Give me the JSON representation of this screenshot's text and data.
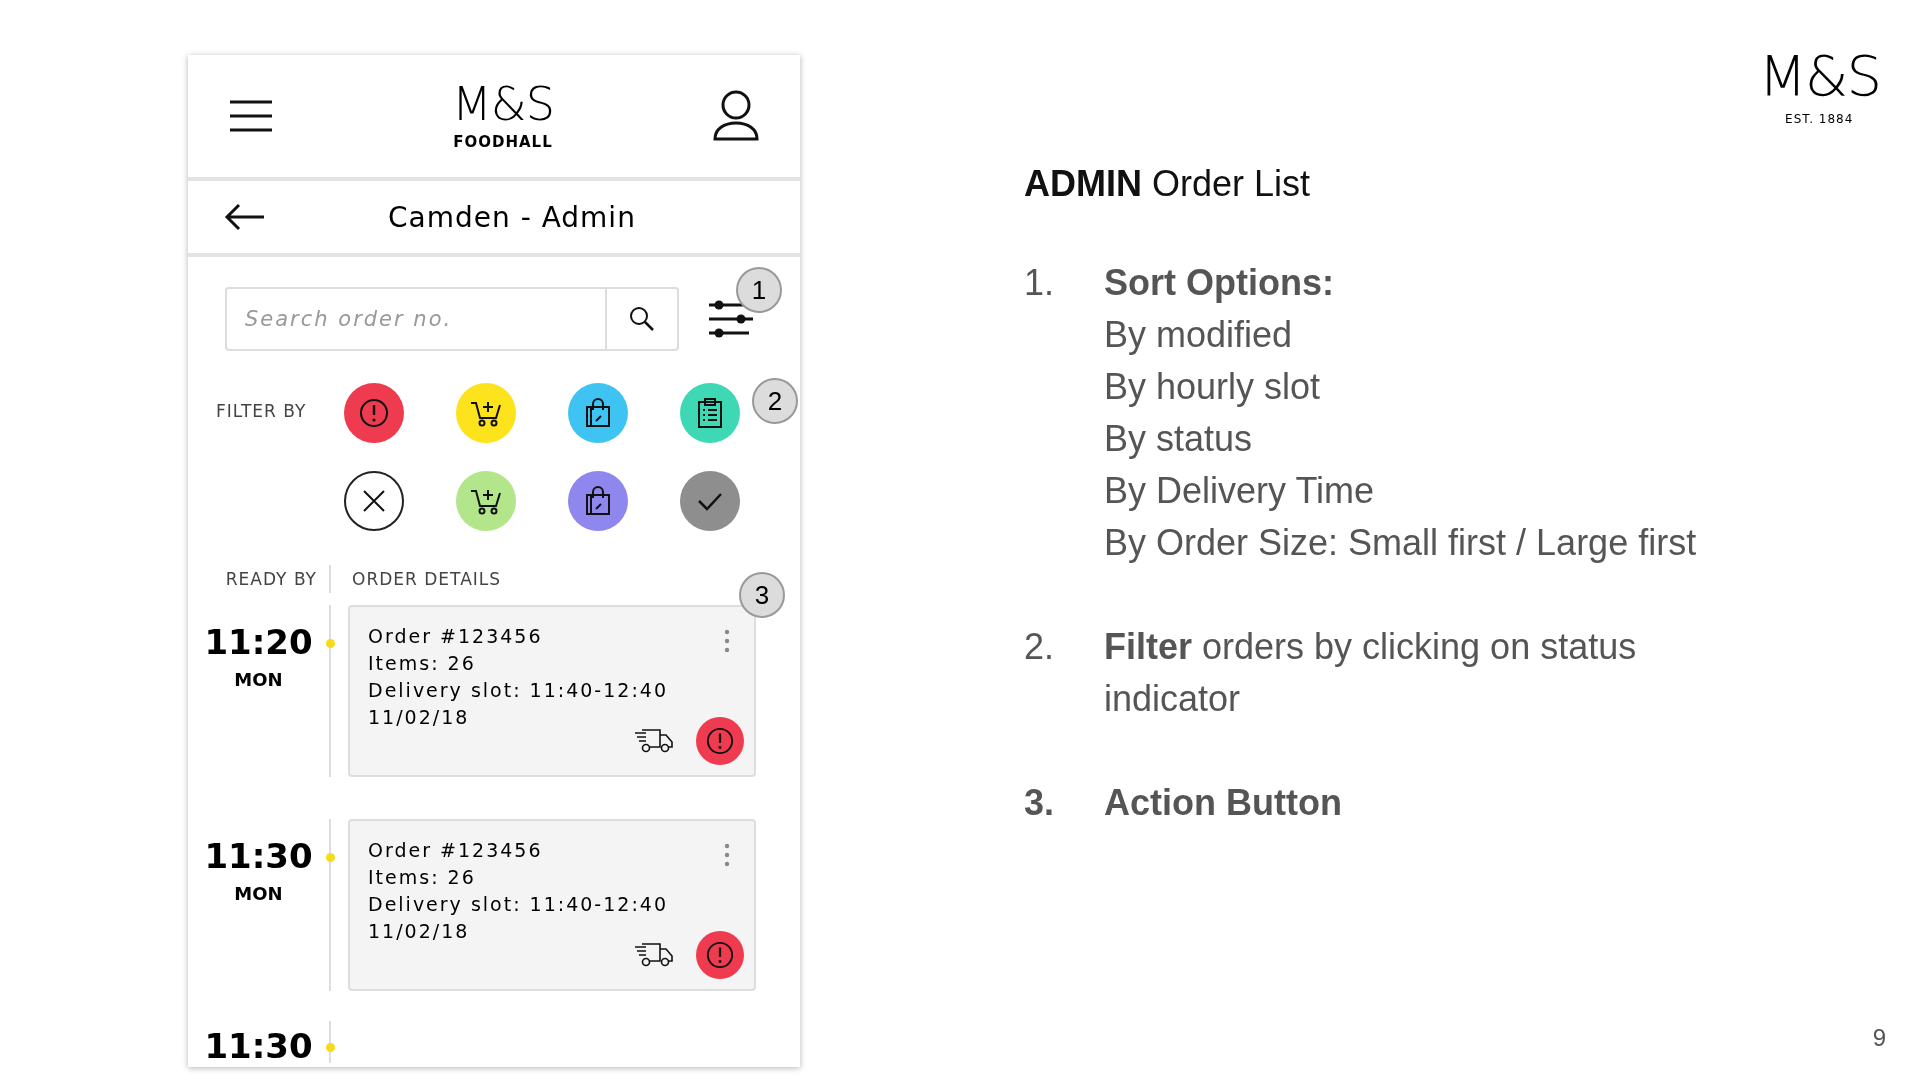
{
  "app": {
    "logo": {
      "brand": "M&S",
      "sub": "FOODHALL"
    },
    "title": "Camden - Admin",
    "search": {
      "placeholder": "Search order no."
    },
    "filter_label": "FILTER BY",
    "filters": [
      {
        "kind": "alert",
        "color": "#ef3b50"
      },
      {
        "kind": "cart",
        "color": "#fde31c"
      },
      {
        "kind": "bag",
        "color": "#3ec3f3"
      },
      {
        "kind": "clipboard",
        "color": "#3ed8b5"
      },
      {
        "kind": "cancel",
        "color": "#ffffff"
      },
      {
        "kind": "cart",
        "color": "#b3e68a"
      },
      {
        "kind": "bag",
        "color": "#8f86ee"
      },
      {
        "kind": "check",
        "color": "#8e8e8e"
      }
    ],
    "columns": [
      "READY BY",
      "ORDER DETAILS"
    ],
    "orders": [
      {
        "time": "11:20",
        "day": "MON",
        "lines": [
          "Order #123456",
          "Items: 26",
          "Delivery slot: 11:40-12:40",
          "11/02/18"
        ]
      },
      {
        "time": "11:30",
        "day": "MON",
        "lines": [
          "Order #123456",
          "Items: 26",
          "Delivery slot: 11:40-12:40",
          "11/02/18"
        ]
      },
      {
        "time": "11:30"
      }
    ],
    "callouts": [
      "1",
      "2",
      "3"
    ]
  },
  "slide": {
    "brand": "M&S",
    "est": "EST. 1884",
    "title": "**ADMIN** Order List",
    "notes": [
      {
        "number": "1.",
        "number_bold": false,
        "lines": [
          "**Sort Options:**",
          "By modified",
          "By hourly slot",
          "By status",
          "By Delivery Time",
          "By Order Size: Small first / Large first"
        ]
      },
      {
        "number": "2.",
        "number_bold": false,
        "lines": [
          "**Filter** orders by clicking on status indicator"
        ]
      },
      {
        "number": "3.",
        "number_bold": true,
        "lines": [
          "**Action Button**"
        ]
      }
    ],
    "page": "9"
  }
}
